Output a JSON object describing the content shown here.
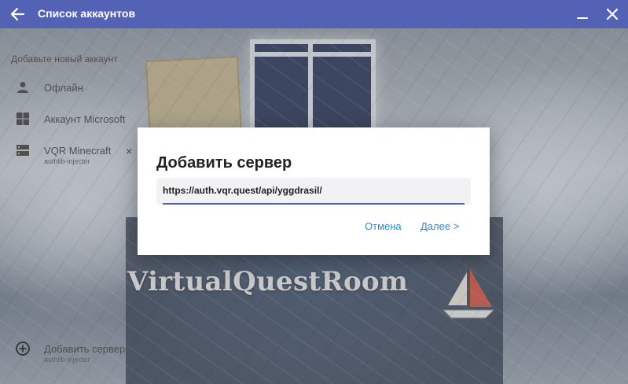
{
  "titlebar": {
    "title": "Список аккаунтов",
    "back_icon": "arrow-left-icon",
    "minimize_icon": "minimize-icon",
    "close_icon": "close-icon",
    "background_color": "#5462b6"
  },
  "background": {
    "watermark": "VirtualQuestRoom"
  },
  "accounts": {
    "heading": "Добавьте новый аккаунт",
    "items": [
      {
        "label": "Офлайн",
        "icon": "person-icon"
      },
      {
        "label": "Аккаунт Microsoft",
        "icon": "windows-icon"
      },
      {
        "label": "VQR Minecraft",
        "sub": "authlib-injector",
        "icon": "server-icon",
        "remove": "×"
      }
    ],
    "add_server": {
      "label": "Добавить сервер",
      "sub": "authlib-injector",
      "icon": "add-circle-icon"
    }
  },
  "dialog": {
    "title": "Добавить сервер",
    "input_value": "https://auth.vqr.quest/api/yggdrasil/",
    "cancel_label": "Отмена",
    "next_label": "Далее >",
    "accent_color": "#1e8bd8"
  }
}
